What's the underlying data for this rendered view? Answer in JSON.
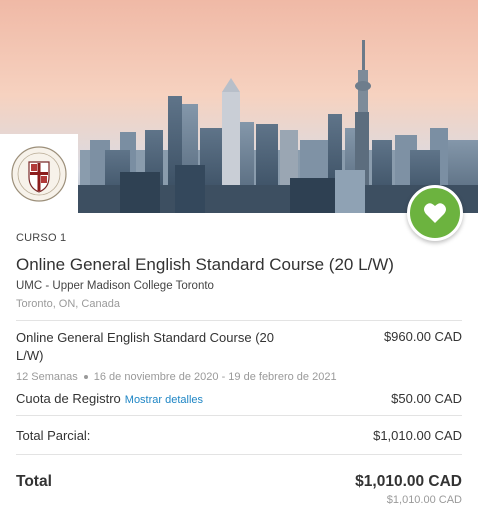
{
  "course": {
    "label": "CURSO 1",
    "title": "Online General English Standard Course (20 L/W)",
    "school": "UMC - Upper Madison College Toronto",
    "location": "Toronto, ON, Canada"
  },
  "line_item": {
    "name": "Online General English Standard Course (20 L/W)",
    "price": "$960.00 CAD",
    "weeks": "12 Semanas",
    "date_range": "16 de noviembre de 2020 - 19 de febrero de 2021"
  },
  "registration_fee": {
    "label": "Cuota de Registro",
    "details_link": "Mostrar detalles",
    "price": "$50.00 CAD"
  },
  "subtotal": {
    "label": "Total Parcial:",
    "value": "$1,010.00 CAD"
  },
  "total": {
    "label": "Total",
    "value": "$1,010.00 CAD",
    "secondary_value": "$1,010.00 CAD"
  },
  "icons": {
    "favorite": "heart-icon",
    "logo": "college-crest-logo"
  },
  "colors": {
    "favorite_button": "#6cb33f",
    "link": "#1f86c5",
    "muted_text": "#9a9a9a"
  }
}
